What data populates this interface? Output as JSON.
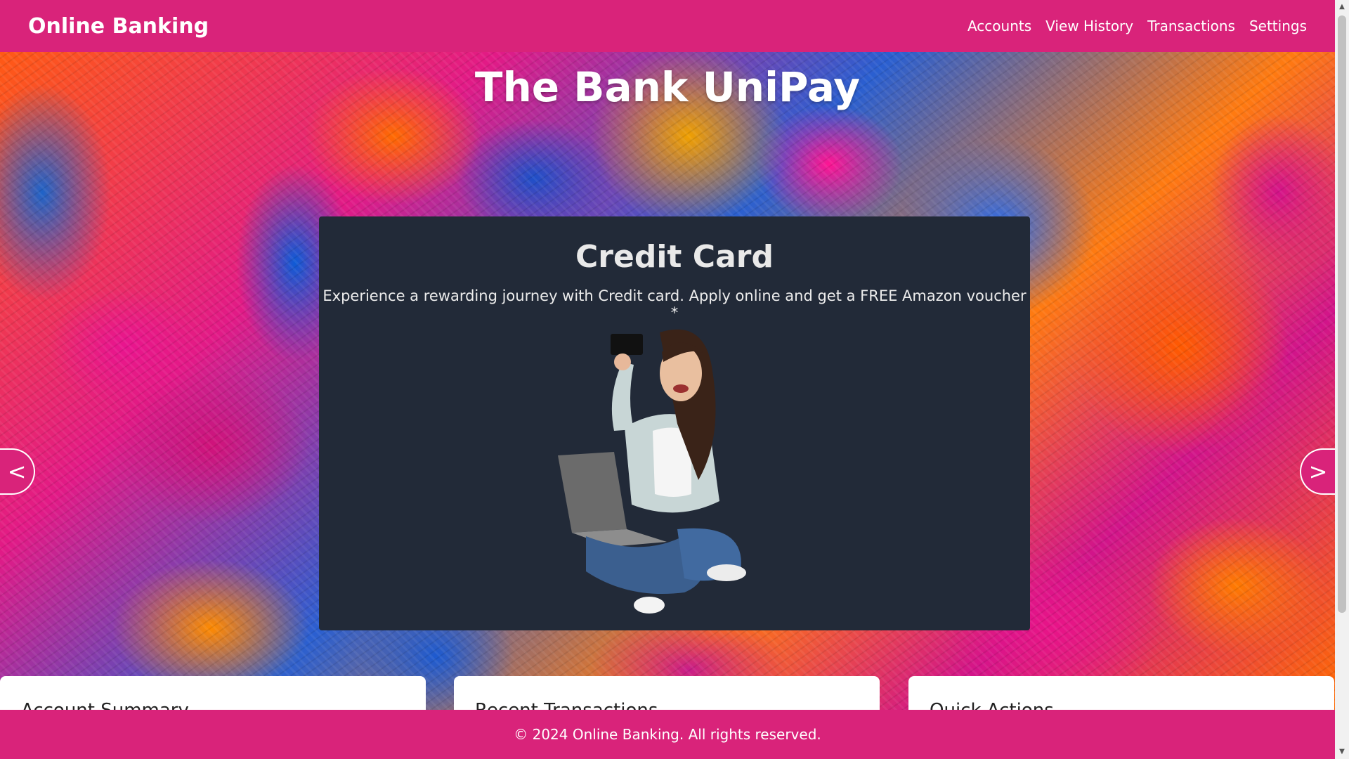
{
  "navbar": {
    "brand": "Online Banking",
    "links": [
      "Accounts",
      "View History",
      "Transactions",
      "Settings"
    ]
  },
  "hero": {
    "title": "The Bank UniPay"
  },
  "carousel": {
    "slide_title": "Credit Card",
    "slide_description": "Experience a rewarding journey with Credit card. Apply online and get a FREE Amazon voucher *",
    "prev_label": "<",
    "next_label": ">"
  },
  "cards": [
    {
      "title": "Account Summary"
    },
    {
      "title": "Recent Transactions"
    },
    {
      "title": "Quick Actions"
    }
  ],
  "footer": {
    "text": "© 2024 Online Banking. All rights reserved."
  },
  "colors": {
    "accent": "#d9237a",
    "card_dark": "#222a38"
  }
}
